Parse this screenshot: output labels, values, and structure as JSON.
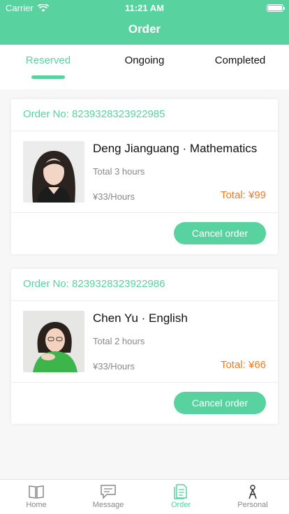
{
  "status_bar": {
    "carrier": "Carrier",
    "time": "11:21 AM"
  },
  "header": {
    "title": "Order"
  },
  "tabs": [
    {
      "label": "Reserved",
      "active": true
    },
    {
      "label": "Ongoing",
      "active": false
    },
    {
      "label": "Completed",
      "active": false
    }
  ],
  "orders": [
    {
      "order_no": "Order No: 8239328323922985",
      "teacher": "Deng Jianguang · Mathematics",
      "hours": "Total 3 hours",
      "rate": "¥33/Hours",
      "total": "Total: ¥99",
      "cancel_label": "Cancel order"
    },
    {
      "order_no": "Order No: 8239328323922986",
      "teacher": "Chen Yu · English",
      "hours": "Total 2 hours",
      "rate": "¥33/Hours",
      "total": "Total: ¥66",
      "cancel_label": "Cancel order"
    }
  ],
  "bottom_nav": [
    {
      "label": "Home",
      "icon": "book-icon",
      "active": false
    },
    {
      "label": "Message",
      "icon": "chat-icon",
      "active": false
    },
    {
      "label": "Order",
      "icon": "document-icon",
      "active": true
    },
    {
      "label": "Personal",
      "icon": "person-icon",
      "active": false
    }
  ],
  "colors": {
    "accent": "#58d3a0",
    "price": "#f07c22",
    "muted_text": "#888888"
  }
}
